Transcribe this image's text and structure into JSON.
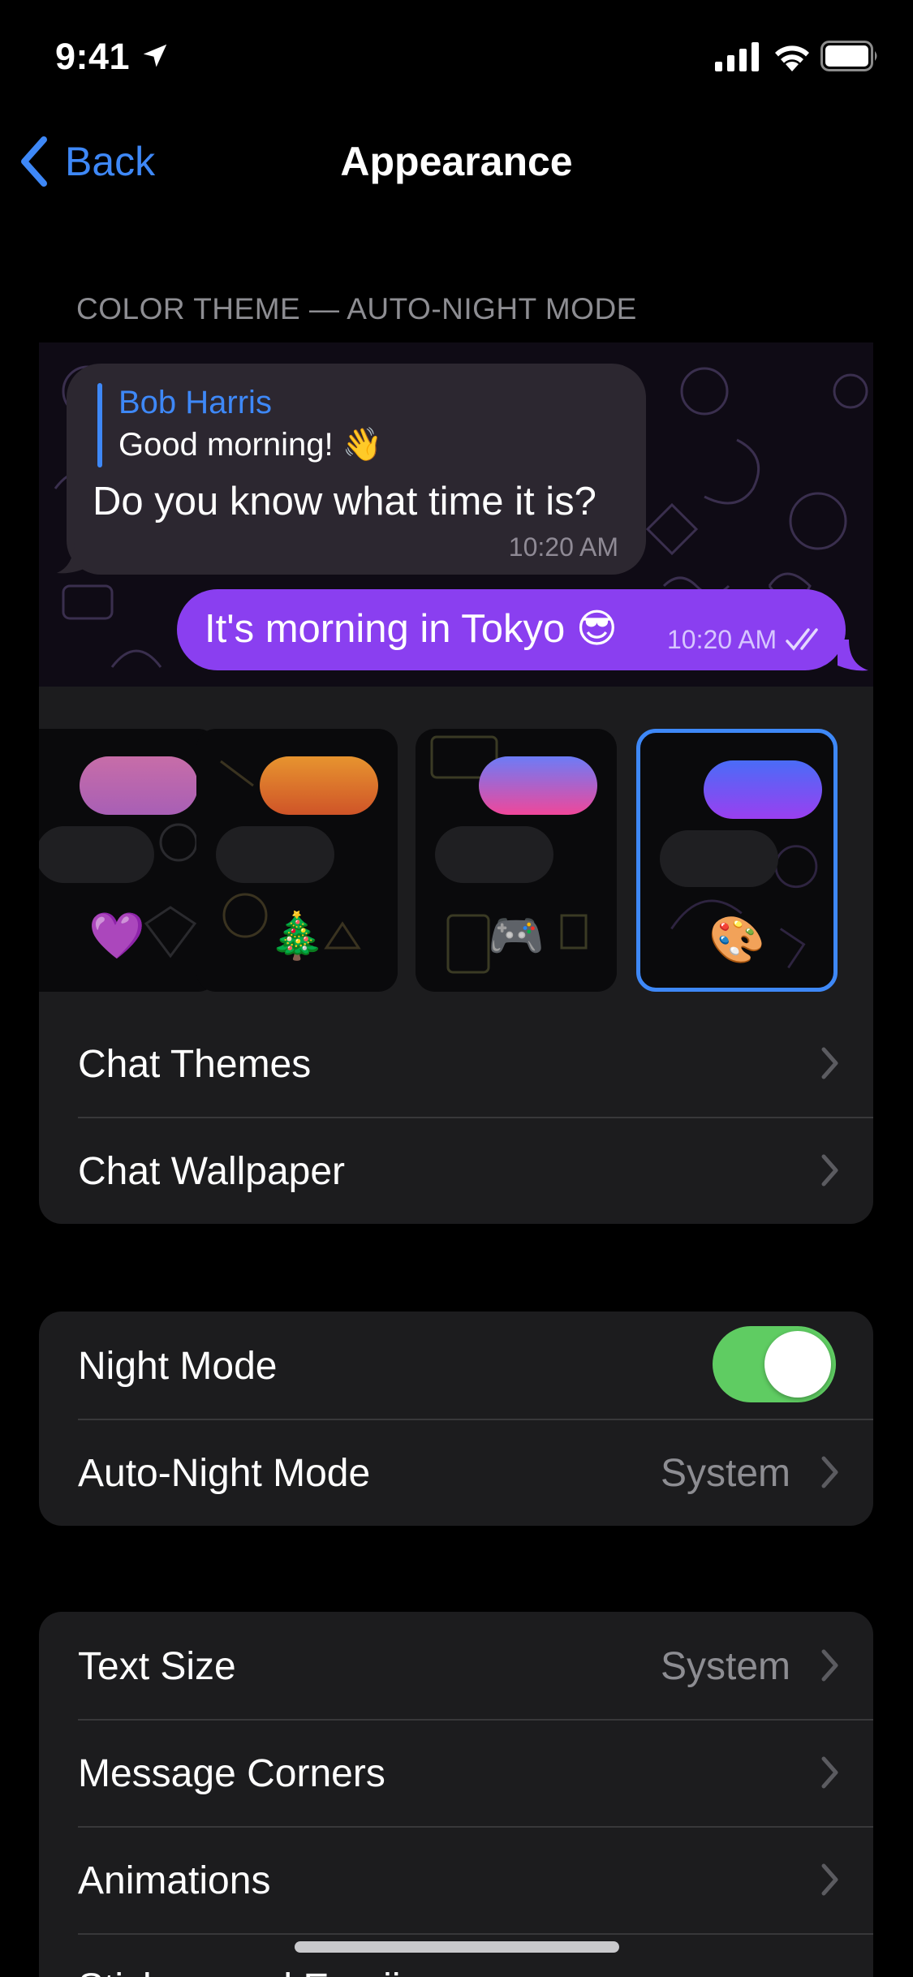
{
  "status_bar": {
    "time": "9:41"
  },
  "nav": {
    "back_label": "Back",
    "title": "Appearance"
  },
  "section_header": "COLOR THEME — AUTO-NIGHT MODE",
  "preview": {
    "reply_name": "Bob Harris",
    "reply_text": "Good morning! 👋",
    "incoming_text": "Do you know what time it is?",
    "incoming_time": "10:20 AM",
    "outgoing_text": "It's morning in Tokyo 😎",
    "outgoing_time": "10:20 AM"
  },
  "themes": [
    {
      "emoji": "💜",
      "selected": false,
      "gradient": [
        "#c76da8",
        "#a85fb5"
      ]
    },
    {
      "emoji": "🎄",
      "selected": false,
      "gradient": [
        "#e7942f",
        "#cf5428"
      ]
    },
    {
      "emoji": "🎮",
      "selected": false,
      "gradient": [
        "#6c7cf7",
        "#f0479a"
      ]
    },
    {
      "emoji": "🎨",
      "selected": true,
      "gradient": [
        "#4a6cf7",
        "#9a3ff0"
      ]
    }
  ],
  "theme_links": [
    {
      "label": "Chat Themes"
    },
    {
      "label": "Chat Wallpaper"
    }
  ],
  "night_section": {
    "night_mode_label": "Night Mode",
    "night_mode_on": true,
    "auto_night_label": "Auto-Night Mode",
    "auto_night_value": "System"
  },
  "text_section": {
    "rows": [
      {
        "label": "Text Size",
        "value": "System"
      },
      {
        "label": "Message Corners",
        "value": ""
      },
      {
        "label": "Animations",
        "value": ""
      },
      {
        "label": "Stickers and Emoji",
        "value": ""
      }
    ]
  },
  "colors": {
    "accent": "#3e88f7",
    "toggle_on": "#5fcc62",
    "outgoing_bubble": "#8a3ff0"
  }
}
